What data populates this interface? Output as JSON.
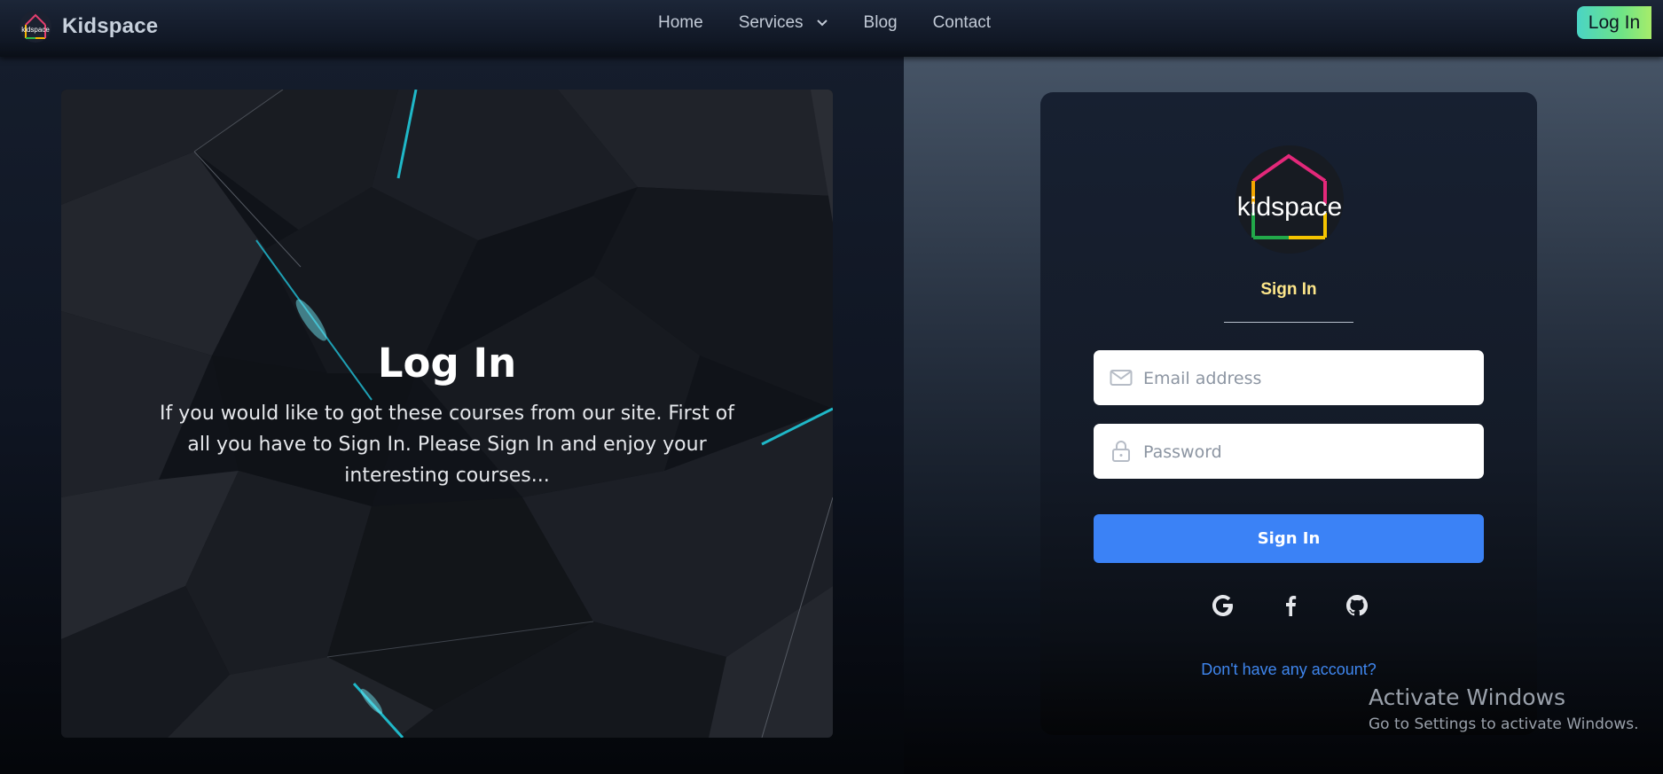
{
  "nav": {
    "brand_name": "Kidspace",
    "brand_logo_text": "kidspace",
    "links": [
      {
        "label": "Home"
      },
      {
        "label": "Services"
      },
      {
        "label": "Blog"
      },
      {
        "label": "Contact"
      }
    ],
    "login_label": "Log In"
  },
  "hero": {
    "title": "Log In",
    "text": "If you would like to got these courses from our site. First of all you have to Sign In. Please Sign In and enjoy your interesting courses..."
  },
  "form": {
    "logo_text": "kidspace",
    "tab_label": "Sign In",
    "email": {
      "placeholder": "Email address",
      "value": "",
      "icon": "mail-icon"
    },
    "password": {
      "placeholder": "Password",
      "value": "",
      "icon": "lock-icon"
    },
    "submit_label": "Sign In",
    "social": [
      "google-icon",
      "facebook-icon",
      "github-icon"
    ],
    "signup_link": "Don't have any account?"
  },
  "watermark": {
    "title": "Activate Windows",
    "subtitle": "Go to Settings to activate Windows."
  },
  "colors": {
    "accent_blue": "#3b82f6",
    "login_gradient": [
      "#4ad4c5",
      "#a7ec6a"
    ],
    "sign_in_tab": "#fde68a",
    "link": "#3f86ee"
  }
}
